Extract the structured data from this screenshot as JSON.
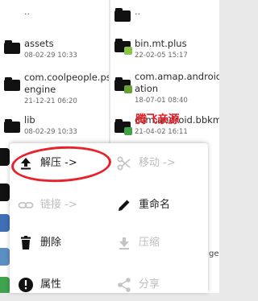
{
  "left_pane": {
    "parent_label": "..",
    "items": [
      {
        "name": "assets",
        "date": "08-02-29 10:33"
      },
      {
        "name": "com.coolpeople.psych\nengine",
        "date": "21-12-21 06:20"
      },
      {
        "name": "lib",
        "date": "08-02-29 10:33"
      }
    ]
  },
  "right_pane": {
    "parent_label": "..",
    "items": [
      {
        "name": "bin.mt.plus",
        "date": "22-02-05 15:17"
      },
      {
        "name": "com.amap.android.loc\nation",
        "date": "18-07-01 08:40"
      },
      {
        "name": "com.android.bbkmusic",
        "date": "21-04-02 16:11"
      }
    ],
    "partial_text": "gei"
  },
  "watermark": "腾飞亲源",
  "context_menu": {
    "items": [
      {
        "label": "解压 ->",
        "icon": "extract-upload-icon",
        "enabled": true
      },
      {
        "label": "移动 ->",
        "icon": "scissors-icon",
        "enabled": false
      },
      {
        "label": "链接 ->",
        "icon": "link-icon",
        "enabled": false
      },
      {
        "label": "重命名",
        "icon": "pencil-icon",
        "enabled": true
      },
      {
        "label": "删除",
        "icon": "trash-icon",
        "enabled": true
      },
      {
        "label": "压缩",
        "icon": "compress-download-icon",
        "enabled": false
      },
      {
        "label": "属性",
        "icon": "info-icon",
        "enabled": true
      },
      {
        "label": "分享",
        "icon": "share-icon",
        "enabled": false
      }
    ]
  },
  "colors": {
    "highlight_ring": "#e8212a",
    "watermark": "#e51c23",
    "disabled_text": "#bdbdbd"
  }
}
